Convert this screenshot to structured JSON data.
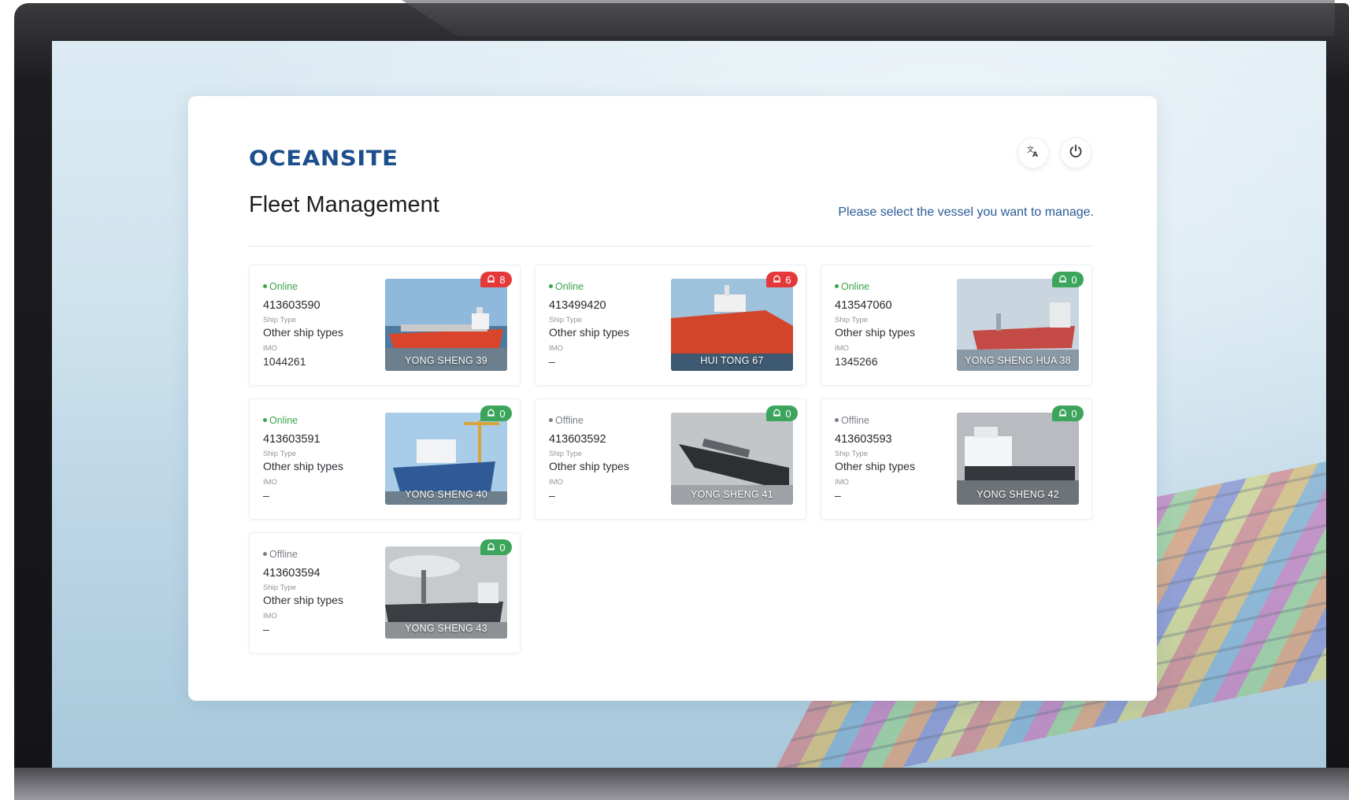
{
  "app": {
    "logo_text": "OCEANSITE",
    "page_title": "Fleet Management",
    "subtitle": "Please select the vessel you want to manage."
  },
  "header_icons": {
    "translate": "translate-icon",
    "power": "power-icon"
  },
  "labels": {
    "ship_type": "Ship Type",
    "imo": "IMO"
  },
  "colors": {
    "brand": "#1d4f8c",
    "online": "#3aa54a",
    "offline": "#7b7f86",
    "alarm_red": "#e5383b",
    "alarm_green": "#3ca55c"
  },
  "vessels": [
    {
      "status": "Online",
      "mmsi": "413603590",
      "ship_type": "Other ship types",
      "imo": "1044261",
      "name": "YONG SHENG 39",
      "alarms": "8",
      "alarm_color": "red",
      "photo": "red-tanker"
    },
    {
      "status": "Online",
      "mmsi": "413499420",
      "ship_type": "Other ship types",
      "imo": "–",
      "name": "HUI TONG 67",
      "alarms": "6",
      "alarm_color": "red",
      "photo": "red-bow"
    },
    {
      "status": "Online",
      "mmsi": "413547060",
      "ship_type": "Other ship types",
      "imo": "1345266",
      "name": "YONG SHENG HUA 38",
      "alarms": "0",
      "alarm_color": "green",
      "photo": "red-muted"
    },
    {
      "status": "Online",
      "mmsi": "413603591",
      "ship_type": "Other ship types",
      "imo": "–",
      "name": "YONG SHENG 40",
      "alarms": "0",
      "alarm_color": "green",
      "photo": "shipyard"
    },
    {
      "status": "Offline",
      "mmsi": "413603592",
      "ship_type": "Other ship types",
      "imo": "–",
      "name": "YONG SHENG 41",
      "alarms": "0",
      "alarm_color": "green",
      "photo": "bw-sea"
    },
    {
      "status": "Offline",
      "mmsi": "413603593",
      "ship_type": "Other ship types",
      "imo": "–",
      "name": "YONG SHENG 42",
      "alarms": "0",
      "alarm_color": "green",
      "photo": "bw-white"
    },
    {
      "status": "Offline",
      "mmsi": "413603594",
      "ship_type": "Other ship types",
      "imo": "–",
      "name": "YONG SHENG 43",
      "alarms": "0",
      "alarm_color": "green",
      "photo": "bw-dock"
    }
  ]
}
